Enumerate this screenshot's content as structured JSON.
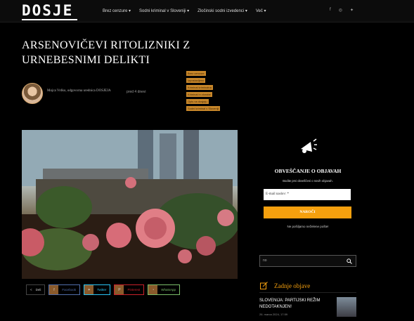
{
  "header": {
    "logo": "DOSJE",
    "nav": [
      {
        "label": "Brez cenzure"
      },
      {
        "label": "Sodni kriminal v Sloveniji"
      },
      {
        "label": "Zločinski sodni izvedenci"
      },
      {
        "label": "Več"
      }
    ],
    "social_icons": [
      "facebook-icon",
      "instagram-icon",
      "twitter-icon"
    ]
  },
  "article": {
    "title": "ARSENOVIČEVI RITOLIZNIKI Z URNEBESNIMI DELIKTI",
    "author": "Mojca Vrdko, odgovorna urednica DOSJEJA",
    "date": "pred 4 dnevi",
    "tags": [
      "Brez cenzure",
      "Izpostavljeno",
      "Kriminal kriminalna",
      "Kriminal in zlorabe",
      "Opis na dosjeju",
      "Sodni kriminal v Sloveniji"
    ],
    "share": {
      "count": "0",
      "label": "Deli",
      "buttons": [
        {
          "label": "Facebook",
          "color": "#516eab",
          "icon": "facebook-icon"
        },
        {
          "label": "Twitter",
          "color": "#29c5f6",
          "icon": "twitter-icon"
        },
        {
          "label": "Pinterest",
          "color": "#ca212a",
          "icon": "pinterest-icon"
        },
        {
          "label": "WhatsApp",
          "color": "#7bbf6a",
          "icon": "whatsapp-icon"
        }
      ]
    }
  },
  "sidebar": {
    "subscribe_title": "OBVEŠČANJE O OBJAVAH",
    "subscribe_text": "Bodite prvi obveščeni o novih objavah.",
    "email_placeholder": "E-mail naslov: *",
    "subscribe_button": "NAROČI",
    "nospam_text": "Ne pošiljamo neželene pošte!",
    "search_value": "no",
    "recent_title": "Zadnje objave",
    "recent_posts": [
      {
        "title": "SLOVENIJA: PARTIJSKI REŽIM NEDOTAKNJEN!",
        "date": "26. marca 2024, 17:59"
      }
    ]
  },
  "colors": {
    "accent": "#f5a00e",
    "tag_bg": "#c8872a",
    "background": "#000000"
  }
}
